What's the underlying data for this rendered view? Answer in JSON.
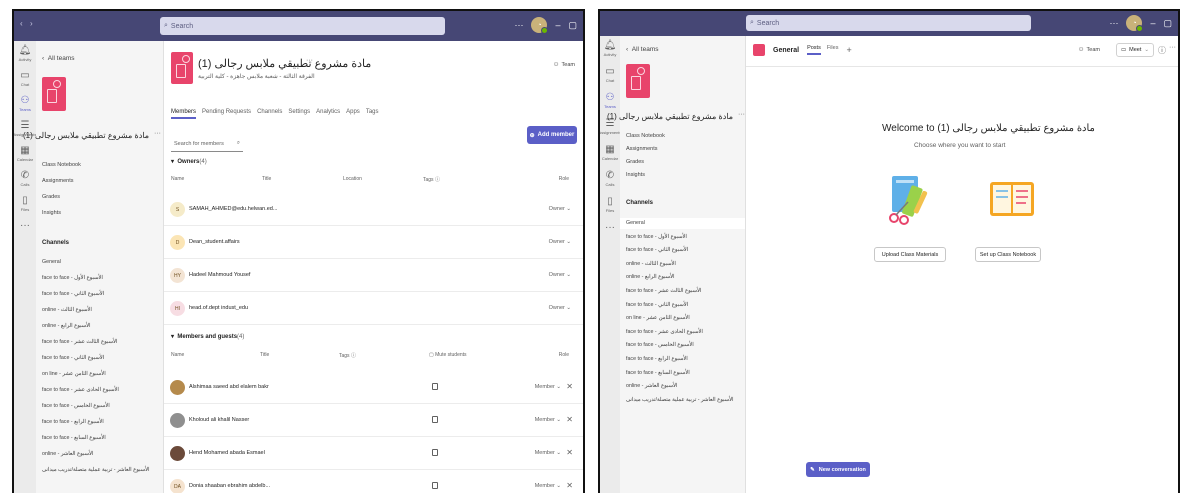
{
  "left": {
    "search_placeholder": "Search",
    "rail": [
      {
        "label": "Activity",
        "icon": "bell-icon"
      },
      {
        "label": "Chat",
        "icon": "chat-icon"
      },
      {
        "label": "Teams",
        "icon": "teams-icon"
      },
      {
        "label": "Assignments",
        "icon": "assignments-icon"
      },
      {
        "label": "Calendar",
        "icon": "calendar-icon"
      },
      {
        "label": "Calls",
        "icon": "phone-icon"
      },
      {
        "label": "Files",
        "icon": "files-icon"
      }
    ],
    "back_label": "All teams",
    "team_name": "مادة مشروع تطبيقي ملابس رجالى (1)",
    "nav": [
      "Class Notebook",
      "Assignments",
      "Grades",
      "Insights"
    ],
    "channels_title": "Channels",
    "channels": [
      "General",
      "face to face - الأسبوع الأول",
      "face to face - الأسبوع الثاني",
      "online - الأسبوع الثالث",
      "online - الأسبوع الرابع",
      "face to face - الأسبوع الثالث عشر",
      "face to face - الأسبوع الثاني",
      "on line - الأسبوع الثامن عشر",
      "face to face - الأسبوع الحادى عشر",
      "face to face - الأسبوع الخامس",
      "face to face - الأسبوع الرابع",
      "face to face - الأسبوع السابع",
      "online - الأسبوع العاشر",
      "الأسبوع العاشر - تربية عملية متصلة/تدريب ميدانى"
    ],
    "main": {
      "title": "مادة مشروع تطبيقي ملابس رجالى (1)",
      "subtitle": "الفرقة الثالثة - شعبة ملابس جاهزة - كلية التربية",
      "team_btn": "Team",
      "tabs": [
        "Members",
        "Pending Requests",
        "Channels",
        "Settings",
        "Analytics",
        "Apps",
        "Tags"
      ],
      "search_placeholder": "Search for members",
      "add_member": "Add member",
      "owners_label": "Owners",
      "owners_count": "(4)",
      "owner_cols": [
        "Name",
        "Title",
        "Location",
        "Tags",
        "Role"
      ],
      "owners": [
        {
          "initials": "S",
          "name": "SAMAH_AHMED@edu.helwan.ed...",
          "role": "Owner",
          "color": "#f5ebc9"
        },
        {
          "initials": "D",
          "name": "Dean_student.affairs",
          "role": "Owner",
          "color": "#fbe5b5"
        },
        {
          "initials": "HY",
          "name": "Hadeel Mahmoud Yousef",
          "role": "Owner",
          "color": "#f3e4d4"
        },
        {
          "initials": "HI",
          "name": "head.of.dept indust_edu",
          "role": "Owner",
          "color": "#f7dde3"
        }
      ],
      "guests_label": "Members and guests",
      "guests_count": "(4)",
      "guest_cols": [
        "Name",
        "Title",
        "Tags",
        "Mute students",
        "Role"
      ],
      "guests": [
        {
          "initials": "",
          "name": "Alshimaa saeed abd elalem bakr",
          "role": "Member",
          "color": "#b58a4c"
        },
        {
          "initials": "",
          "name": "Kholoud ali khalil Nasser",
          "role": "Member",
          "color": "#8f8f8f"
        },
        {
          "initials": "",
          "name": "Hend Mohamed abada Esmael",
          "role": "Member",
          "color": "#6b4a3a"
        },
        {
          "initials": "DA",
          "name": "Donia shaaban ebrahim abdelb...",
          "role": "Member",
          "color": "#f5e3cf"
        }
      ]
    }
  },
  "right": {
    "search_placeholder": "Search",
    "rail": [
      {
        "label": "Activity",
        "icon": "bell-icon"
      },
      {
        "label": "Chat",
        "icon": "chat-icon"
      },
      {
        "label": "Teams",
        "icon": "teams-icon"
      },
      {
        "label": "Assignments",
        "icon": "assignments-icon"
      },
      {
        "label": "Calendar",
        "icon": "calendar-icon"
      },
      {
        "label": "Calls",
        "icon": "phone-icon"
      },
      {
        "label": "Files",
        "icon": "files-icon"
      }
    ],
    "back_label": "All teams",
    "team_name": "مادة مشروع تطبيقي ملابس رجالى (1)",
    "nav": [
      "Class Notebook",
      "Assignments",
      "Grades",
      "Insights"
    ],
    "channels_title": "Channels",
    "channels": [
      "General",
      "face to face - الأسبوع الأول",
      "face to face - الأسبوع الثاني",
      "online - الأسبوع الثالث",
      "online - الأسبوع الرابع",
      "face to face - الأسبوع الثالث عشر",
      "face to face - الأسبوع الثاني",
      "on line - الأسبوع الثامن عشر",
      "face to face - الأسبوع الحادى عشر",
      "face to face - الأسبوع الخامس",
      "face to face - الأسبوع الرابع",
      "face to face - الأسبوع السابع",
      "online - الأسبوع العاشر",
      "الأسبوع العاشر - تربية عملية متصلة/تدريب ميدانى"
    ],
    "channel_name": "General",
    "tabs": [
      "Posts",
      "Files"
    ],
    "team_btn": "Team",
    "meet_btn": "Meet",
    "welcome": "Welcome to مادة مشروع تطبيقي ملابس رجالى (1)",
    "choose": "Choose where you want to start",
    "upload_btn": "Upload Class Materials",
    "notebook_btn": "Set up Class Notebook",
    "new_conversation": "New conversation"
  }
}
